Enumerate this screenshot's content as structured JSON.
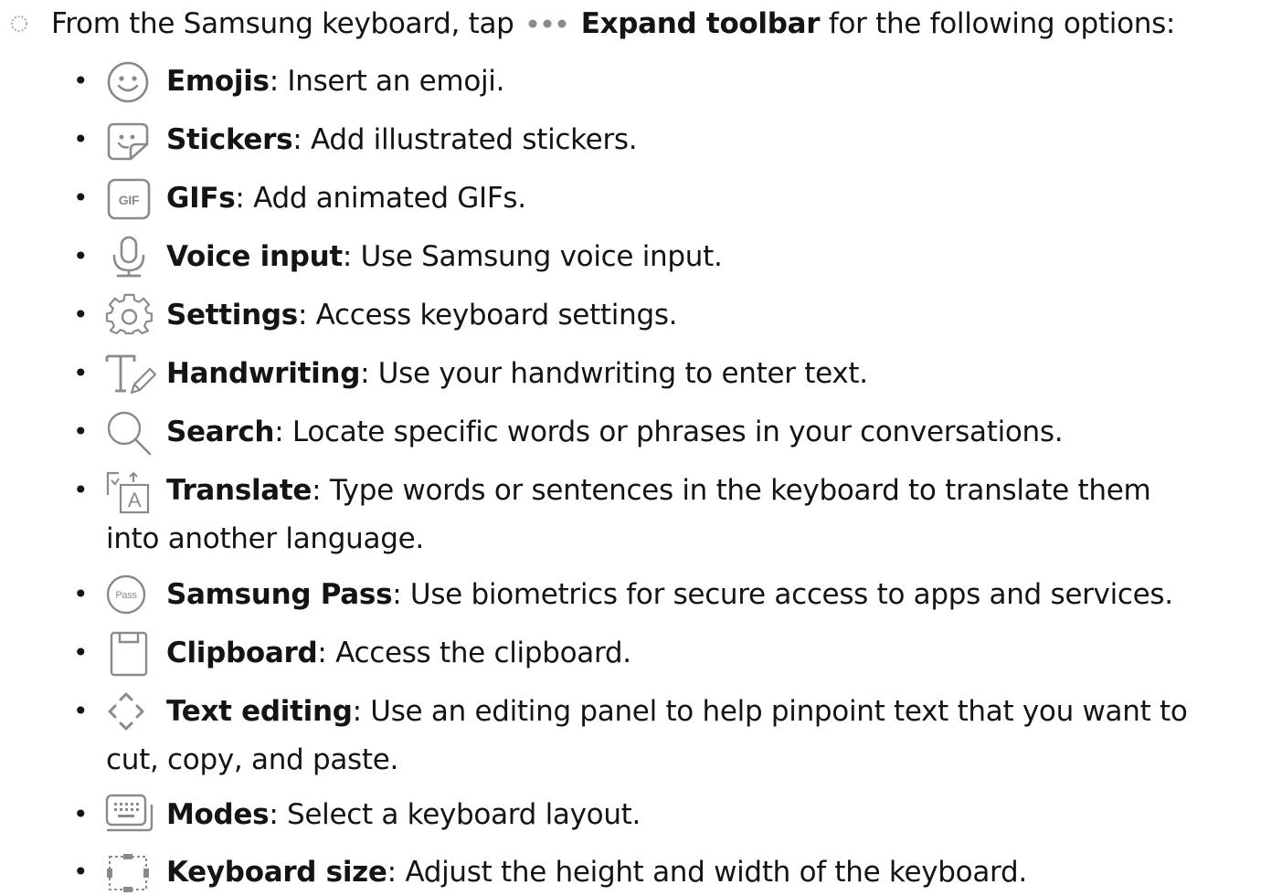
{
  "intro": {
    "prefix": "From the Samsung keyboard, tap",
    "action": "Expand toolbar",
    "suffix": "for the following options:"
  },
  "items": [
    {
      "label": "Emojis",
      "desc": ": Insert an emoji.",
      "icon": "emoji-icon"
    },
    {
      "label": "Stickers",
      "desc": ": Add illustrated stickers.",
      "icon": "sticker-icon"
    },
    {
      "label": "GIFs",
      "desc": ": Add animated GIFs.",
      "icon": "gif-icon",
      "icon_text": "GIF"
    },
    {
      "label": "Voice input",
      "desc": ": Use Samsung voice input.",
      "icon": "microphone-icon"
    },
    {
      "label": "Settings",
      "desc": ": Access keyboard settings.",
      "icon": "gear-icon"
    },
    {
      "label": "Handwriting",
      "desc": ": Use your handwriting to enter text.",
      "icon": "handwriting-icon"
    },
    {
      "label": "Search",
      "desc": ": Locate specific words or phrases in your conversations.",
      "icon": "search-icon"
    },
    {
      "label": "Translate",
      "desc": ": Type words or sentences in the keyboard to translate them",
      "desc2": "into another language.",
      "icon": "translate-icon",
      "icon_text": "A"
    },
    {
      "label": "Samsung Pass",
      "desc": ": Use biometrics for secure access to apps and services.",
      "icon": "samsung-pass-icon",
      "icon_text": "Pass"
    },
    {
      "label": "Clipboard",
      "desc": ": Access the clipboard.",
      "icon": "clipboard-icon"
    },
    {
      "label": "Text editing",
      "desc": ": Use an editing panel to help pinpoint text that you want to",
      "desc2": "cut, copy, and paste.",
      "icon": "text-editing-icon"
    },
    {
      "label": "Modes",
      "desc": ": Select a keyboard layout.",
      "icon": "keyboard-modes-icon"
    },
    {
      "label": "Keyboard size",
      "desc": ": Adjust the height and width of the keyboard.",
      "icon": "keyboard-size-icon"
    }
  ],
  "colors": {
    "text": "#141414",
    "icon": "#8a8a8a"
  }
}
